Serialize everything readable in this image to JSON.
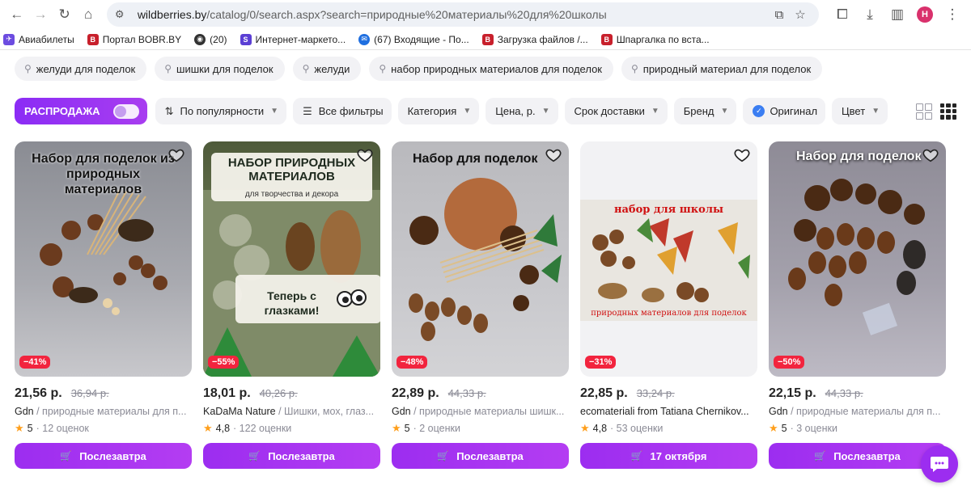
{
  "browser": {
    "url_host": "wildberries.by",
    "url_path": "/catalog/0/search.aspx?search=природные%20материалы%20для%20школы",
    "profile_initial": "Н"
  },
  "bookmarks": [
    {
      "label": "Авиабилеты",
      "color": "#6c4ce0",
      "glyph": "✈"
    },
    {
      "label": "Портал BOBR.BY",
      "color": "#c8202c",
      "glyph": "B"
    },
    {
      "label": "(20)",
      "color": "#333333",
      "glyph": "◉"
    },
    {
      "label": "Интернет-маркето...",
      "color": "#5b3fd4",
      "glyph": "S"
    },
    {
      "label": "(67) Входящие - По...",
      "color": "#1f6fe0",
      "glyph": "✉"
    },
    {
      "label": "Загрузка файлов /...",
      "color": "#c8202c",
      "glyph": "B"
    },
    {
      "label": "Шпаргалка по вста...",
      "color": "#c8202c",
      "glyph": "B"
    }
  ],
  "chips": [
    "желуди для поделок",
    "шишки для поделок",
    "желуди",
    "набор природных материалов для поделок",
    "природный материал для поделок"
  ],
  "filters": {
    "sale_label": "РАСПРОДАЖА",
    "sort_label": "По популярности",
    "all_filters_label": "Все фильтры",
    "category_label": "Категория",
    "price_label": "Цена, р.",
    "delivery_label": "Срок доставки",
    "brand_label": "Бренд",
    "original_label": "Оригинал",
    "color_label": "Цвет"
  },
  "products": [
    {
      "price": "21,56 р.",
      "old_price": "36,94 р.",
      "brand": "Gdn",
      "desc": " / природные материалы для п...",
      "rating": "5",
      "reviews": "· 12 оценок",
      "discount": "−41%",
      "button": "Послезавтра",
      "caption": "Набор для поделок из природных материалов"
    },
    {
      "price": "18,01 р.",
      "old_price": "40,26 р.",
      "brand": "KaDaMa Nature",
      "desc": " / Шишки, мох, глаз...",
      "rating": "4,8",
      "reviews": "· 122 оценки",
      "discount": "−55%",
      "button": "Послезавтра",
      "caption": "НАБОР ПРИРОДНЫХ МАТЕРИАЛОВ",
      "caption2": "для творчества и декора",
      "caption3": "Теперь с глазками!"
    },
    {
      "price": "22,89 р.",
      "old_price": "44,33 р.",
      "brand": "Gdn",
      "desc": " / природные материалы шишк...",
      "rating": "5",
      "reviews": "· 2 оценки",
      "discount": "−48%",
      "button": "Послезавтра",
      "caption": "Набор для поделок"
    },
    {
      "price": "22,85 р.",
      "old_price": "33,24 р.",
      "brand": "ecomateriali from Tatiana Chernikov...",
      "desc": "",
      "rating": "4,8",
      "reviews": "· 53 оценки",
      "discount": "−31%",
      "button": "17 октября",
      "caption": "набор для школы",
      "caption2": "природных материалов для поделок"
    },
    {
      "price": "22,15 р.",
      "old_price": "44,33 р.",
      "brand": "Gdn",
      "desc": " / природные материалы для п...",
      "rating": "5",
      "reviews": "· 3 оценки",
      "discount": "−50%",
      "button": "Послезавтра",
      "caption": "Набор для поделок"
    }
  ],
  "colors": {
    "accent": "#9c2df0",
    "discount": "#f2243e",
    "star": "#ff9f1c"
  }
}
